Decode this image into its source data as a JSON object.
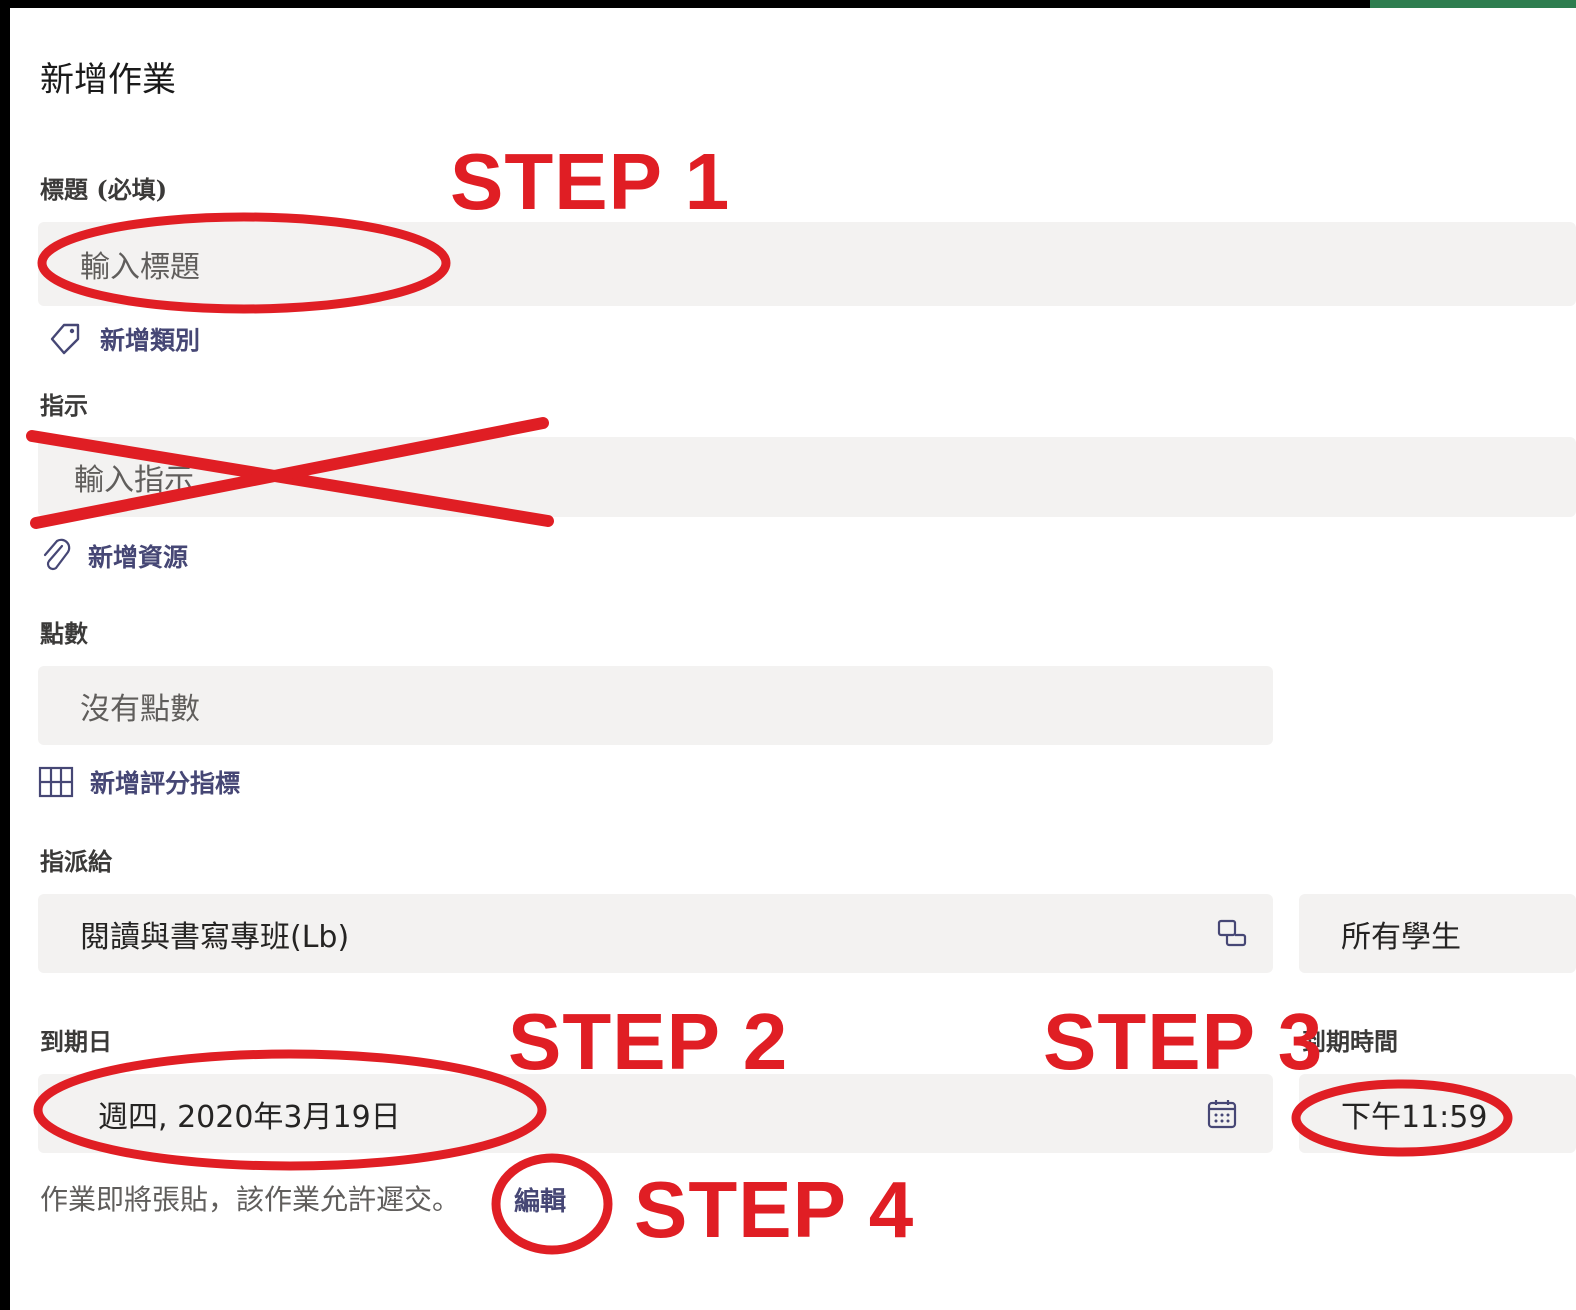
{
  "dialog": {
    "title": "新增作業"
  },
  "title_section": {
    "label": "標題 (必填)",
    "placeholder": "輸入標題"
  },
  "category_link": {
    "label": "新增類別",
    "icon": "tag-icon"
  },
  "instructions_section": {
    "label": "指示",
    "placeholder": "輸入指示"
  },
  "resource_link": {
    "label": "新增資源",
    "icon": "paperclip-icon"
  },
  "points_section": {
    "label": "點數",
    "value": "沒有點數"
  },
  "rubric_link": {
    "label": "新增評分指標",
    "icon": "grid-icon"
  },
  "assign_section": {
    "label": "指派給",
    "class_value": "閱讀與書寫專班(Lb)",
    "students_value": "所有學生"
  },
  "due_date_section": {
    "label": "到期日",
    "value": "週四, 2020年3月19日",
    "icon": "calendar-icon"
  },
  "due_time_section": {
    "label": "到期時間",
    "value": "下午11:59"
  },
  "footer": {
    "note": "作業即將張貼，該作業允許遲交。",
    "edit_label": "編輯"
  },
  "annotations": {
    "step1": "STEP 1",
    "step2": "STEP 2",
    "step3": "STEP 3",
    "step4": "STEP 4",
    "color": "#e01e24"
  },
  "colors": {
    "field_bg": "#f3f2f1",
    "link": "#464775",
    "accent_green": "#2e7d4f"
  }
}
